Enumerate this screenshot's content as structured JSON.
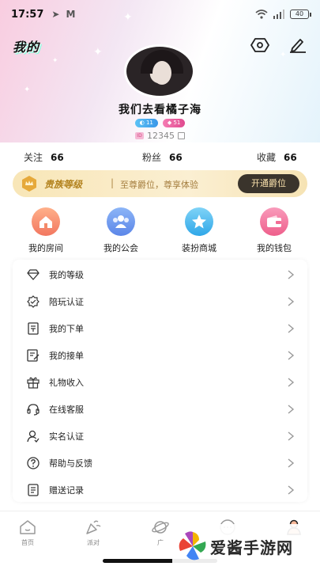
{
  "status_bar": {
    "time": "17:57",
    "battery": "40"
  },
  "header": {
    "title": "我的"
  },
  "profile": {
    "username": "我们去看橘子海",
    "badge_level": "11",
    "badge_charm": "51",
    "user_id": "12345"
  },
  "stats": {
    "following_label": "关注",
    "following_count": "66",
    "fans_label": "粉丝",
    "fans_count": "66",
    "favorites_label": "收藏",
    "favorites_count": "66"
  },
  "vip": {
    "title": "贵族等级",
    "separator": "|",
    "description": "至尊爵位，尊享体验",
    "button_label": "开通爵位"
  },
  "quick_actions": [
    {
      "label": "我的房间",
      "icon": "home-icon",
      "color": "#f38b6a"
    },
    {
      "label": "我的公会",
      "icon": "group-icon",
      "color": "#6a9cf0"
    },
    {
      "label": "装扮商城",
      "icon": "star-icon",
      "color": "#4cbef0"
    },
    {
      "label": "我的钱包",
      "icon": "wallet-icon",
      "color": "#f26d95"
    }
  ],
  "menu": [
    {
      "label": "我的等级",
      "icon": "diamond-icon"
    },
    {
      "label": "陪玩认证",
      "icon": "verified-badge-icon"
    },
    {
      "label": "我的下单",
      "icon": "order-icon"
    },
    {
      "label": "我的接单",
      "icon": "receive-order-icon"
    },
    {
      "label": "礼物收入",
      "icon": "gift-icon"
    },
    {
      "label": "在线客服",
      "icon": "headset-icon"
    },
    {
      "label": "实名认证",
      "icon": "id-user-icon"
    },
    {
      "label": "帮助与反馈",
      "icon": "help-icon"
    },
    {
      "label": "赠送记录",
      "icon": "record-icon"
    }
  ],
  "tabbar": [
    {
      "label": "首页",
      "icon": "home-tab-icon"
    },
    {
      "label": "派对",
      "icon": "party-icon"
    },
    {
      "label": "广",
      "icon": "planet-icon"
    },
    {
      "label": "",
      "icon": "chat-icon"
    },
    {
      "label": "",
      "icon": "profile-icon"
    }
  ],
  "watermark": {
    "text": "爱酱手游网"
  }
}
